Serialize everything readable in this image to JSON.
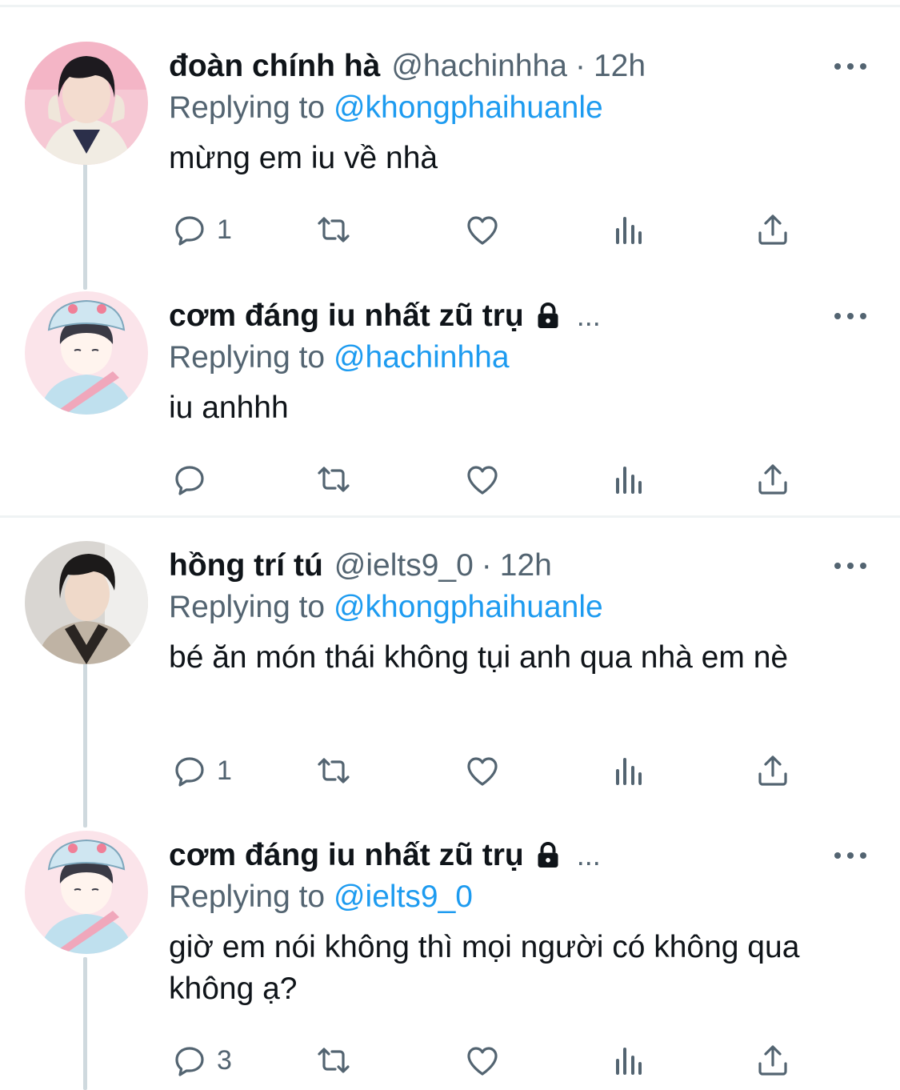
{
  "tweets": [
    {
      "name": "đoàn chính hà",
      "handle": "@hachinhha",
      "separator": "·",
      "time": "12h",
      "replying_prefix": "Replying to",
      "replying_to": "@khongphaihuanle",
      "body": "mừng em iu về nhà",
      "reply_count": "1"
    },
    {
      "name": "cơm đáng iu nhất zũ trụ",
      "truncation": "...",
      "replying_prefix": "Replying to",
      "replying_to": "@hachinhha",
      "body": "iu anhhh",
      "reply_count": ""
    },
    {
      "name": "hồng trí tú",
      "handle": "@ielts9_0",
      "separator": "·",
      "time": "12h",
      "replying_prefix": "Replying to",
      "replying_to": "@khongphaihuanle",
      "body": "bé ăn món thái không tụi anh qua nhà em nè",
      "reply_count": "1"
    },
    {
      "name": "cơm đáng iu nhất zũ trụ",
      "truncation": "...",
      "replying_prefix": "Replying to",
      "replying_to": "@ielts9_0",
      "body": "giờ em nói không thì mọi người có không qua không ạ?",
      "reply_count": "3"
    }
  ],
  "colors": {
    "text": "#0f1419",
    "secondary": "#536471",
    "link": "#1d9bf0",
    "divider": "#eff3f4",
    "thread_line": "#cfd9de"
  },
  "icons": [
    "reply-icon",
    "retweet-icon",
    "like-icon",
    "views-icon",
    "share-icon",
    "more-icon",
    "lock-icon"
  ]
}
